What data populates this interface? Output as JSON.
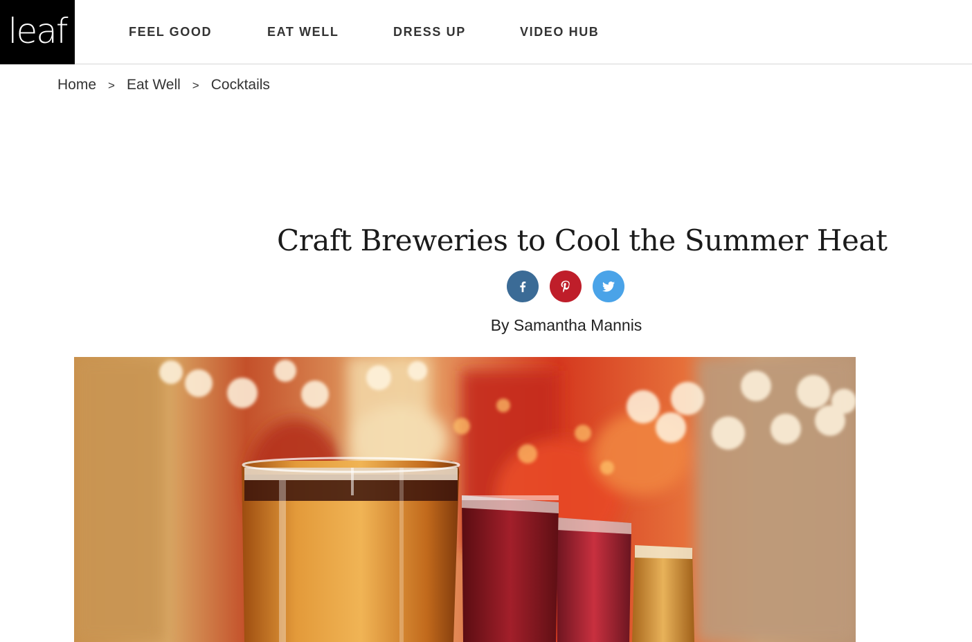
{
  "header": {
    "logo_text": "leaf",
    "nav": [
      {
        "label": "FEEL GOOD"
      },
      {
        "label": "EAT WELL"
      },
      {
        "label": "DRESS UP"
      },
      {
        "label": "VIDEO HUB"
      }
    ]
  },
  "breadcrumb": {
    "items": [
      {
        "label": "Home"
      },
      {
        "label": "Eat Well"
      },
      {
        "label": "Cocktails"
      }
    ],
    "separator": ">"
  },
  "article": {
    "title": "Craft Breweries to Cool the Summer Heat",
    "byline": "By Samantha Mannis"
  },
  "share": {
    "facebook_icon": "facebook-icon",
    "pinterest_icon": "pinterest-icon",
    "twitter_icon": "twitter-icon",
    "colors": {
      "facebook": "#3b6b96",
      "pinterest": "#bf1e2a",
      "twitter": "#4aa3e8"
    }
  },
  "hero_image": {
    "subject": "beer-glasses-image"
  }
}
